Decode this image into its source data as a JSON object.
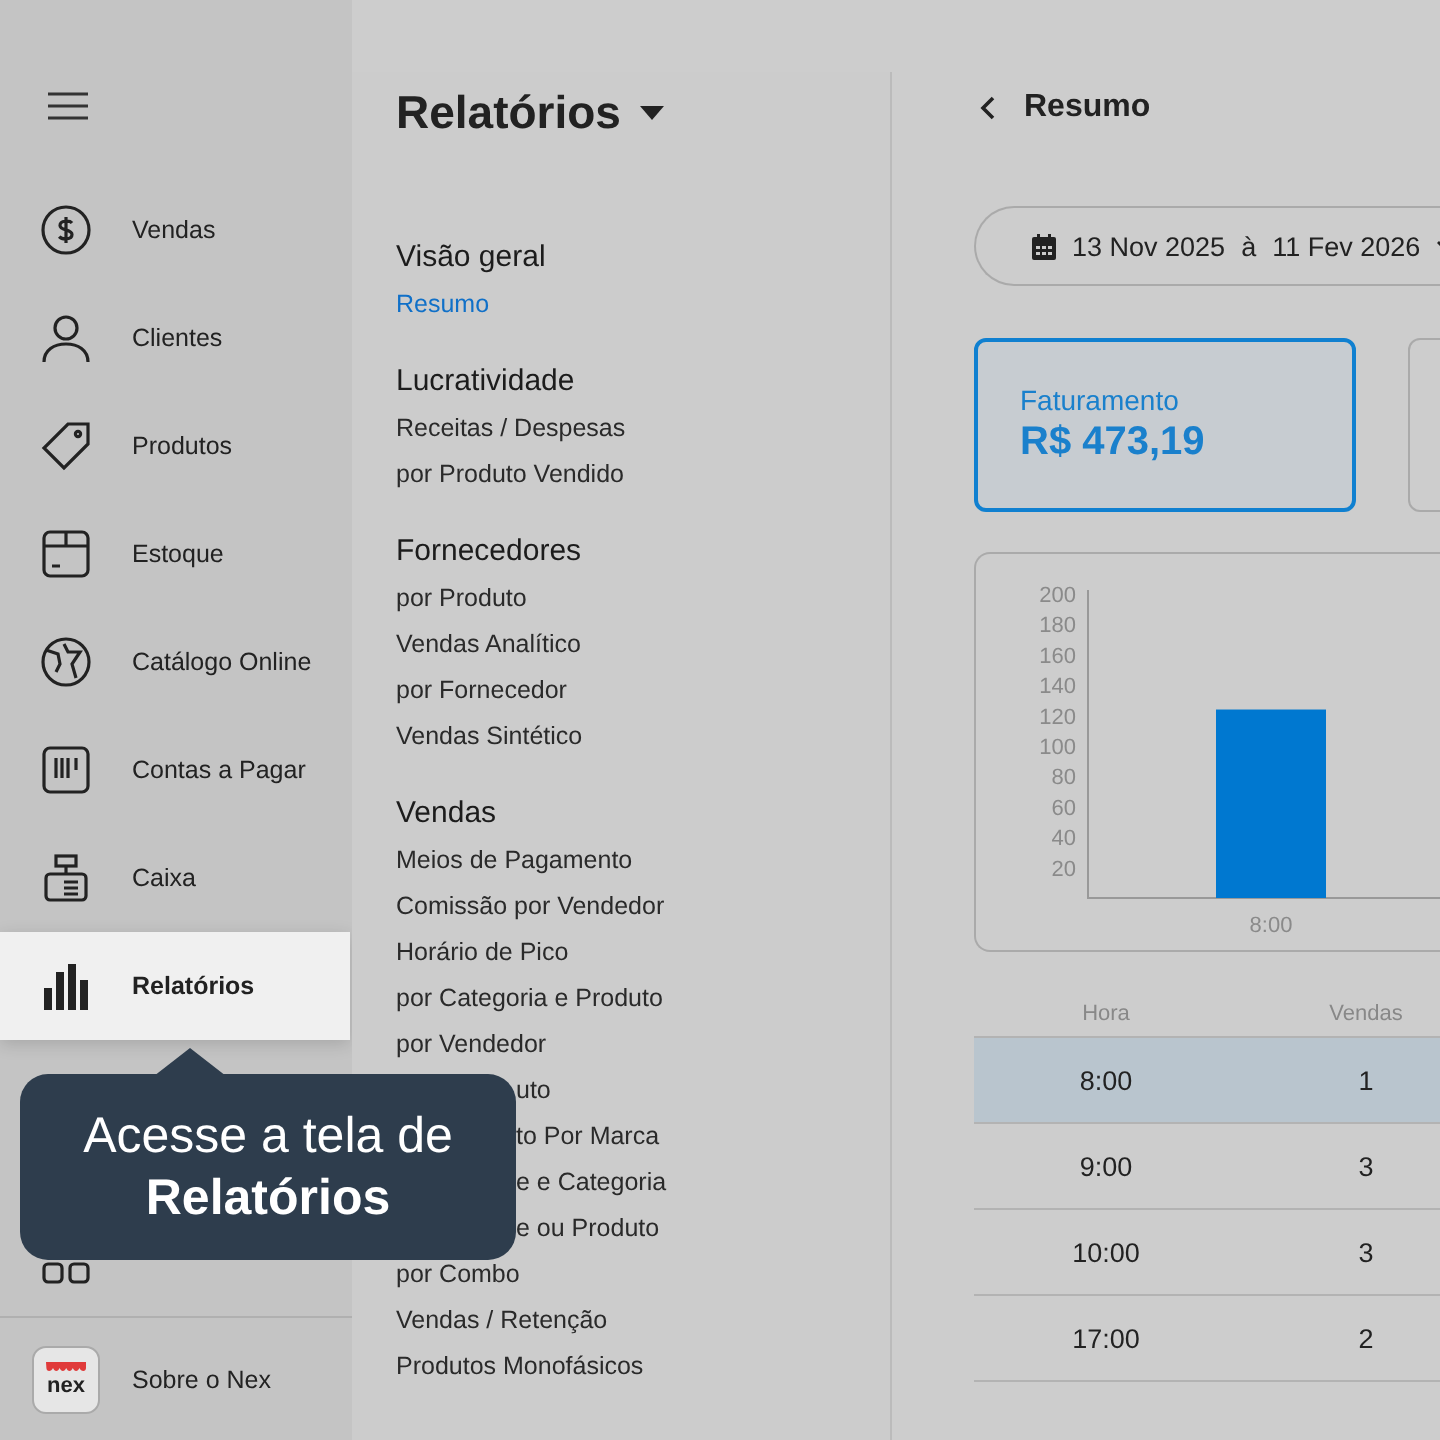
{
  "sidebar": {
    "items": [
      {
        "label": "Vendas",
        "selected": false
      },
      {
        "label": "Clientes",
        "selected": false
      },
      {
        "label": "Produtos",
        "selected": false
      },
      {
        "label": "Estoque",
        "selected": false
      },
      {
        "label": "Catálogo Online",
        "selected": false
      },
      {
        "label": "Contas a Pagar",
        "selected": false
      },
      {
        "label": "Caixa",
        "selected": false
      },
      {
        "label": "Relatórios",
        "selected": true
      },
      {
        "selected": false
      }
    ],
    "footer": {
      "logo_text": "nex",
      "label": "Sobre o Nex"
    }
  },
  "tooltip": {
    "text": "Acesse a tela de **Relatórios**"
  },
  "reports": {
    "title": "Relatórios",
    "sections": [
      {
        "heading": "Visão geral",
        "items": [
          {
            "label": "Resumo",
            "selected": true
          }
        ]
      },
      {
        "heading": "Lucratividade",
        "items": [
          {
            "label": "Receitas / Despesas",
            "selected": false
          },
          {
            "label": "por Produto Vendido",
            "selected": false
          }
        ]
      },
      {
        "heading": "Fornecedores",
        "items": [
          {
            "label": "por Produto",
            "selected": false
          },
          {
            "label": "Vendas Analítico",
            "selected": false
          },
          {
            "label": "por Fornecedor",
            "selected": false
          },
          {
            "label": "Vendas Sintético",
            "selected": false
          }
        ]
      },
      {
        "heading": "Vendas",
        "items": [
          {
            "label": "Meios de Pagamento",
            "selected": false
          },
          {
            "label": "Comissão por Vendedor",
            "selected": false
          },
          {
            "label": "Horário de Pico",
            "selected": false
          },
          {
            "label": "por Categoria e Produto",
            "selected": false
          },
          {
            "label": "por Vendedor",
            "selected": false
          },
          {
            "label": "uto",
            "kind": "covered",
            "selected": false
          },
          {
            "label": "to Por Marca",
            "kind": "covered",
            "selected": false
          },
          {
            "label": "e e Categoria",
            "kind": "covered",
            "selected": false
          },
          {
            "label": "e ou Produto",
            "kind": "covered",
            "selected": false
          },
          {
            "label": "por Combo",
            "selected": false
          },
          {
            "label": "Vendas / Retenção",
            "selected": false
          },
          {
            "label": "Produtos Monofásicos",
            "selected": false
          }
        ]
      }
    ]
  },
  "content": {
    "title": "Resumo",
    "date_range": {
      "start": "13 Nov 2025",
      "separator": "à",
      "end": "11 Fev 2026"
    },
    "cards": [
      {
        "label": "Faturamento",
        "value": "R$ 473,19",
        "selected": true
      },
      {
        "selected": false
      }
    ],
    "chart_data": {
      "type": "bar",
      "categories": [
        "8:00"
      ],
      "values": [
        124
      ],
      "ylim": [
        0,
        200
      ],
      "yticks": [
        20,
        40,
        60,
        80,
        100,
        120,
        140,
        160,
        180,
        200
      ]
    },
    "table": {
      "columns": [
        "Hora",
        "Vendas"
      ],
      "rows": [
        {
          "cells": [
            "8:00",
            "1"
          ],
          "selected": true
        },
        {
          "cells": [
            "9:00",
            "3"
          ],
          "selected": false
        },
        {
          "cells": [
            "10:00",
            "3"
          ],
          "selected": false
        },
        {
          "cells": [
            "17:00",
            "2"
          ],
          "selected": false
        }
      ]
    }
  }
}
